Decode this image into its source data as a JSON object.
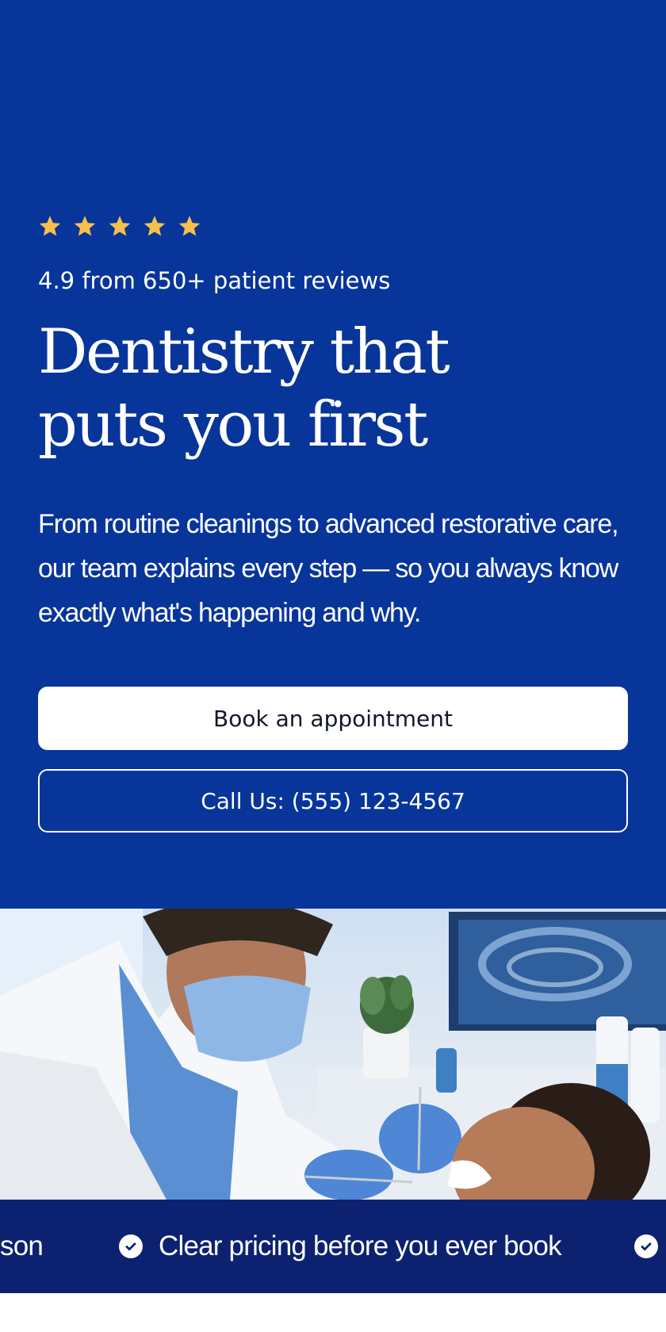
{
  "hero": {
    "rating_text": "4.9 from 650+ patient reviews",
    "star_count": 5,
    "star_color": "#f6c04b",
    "headline_line1": "Dentistry that",
    "headline_line2": "puts you first",
    "subtitle": "From routine cleanings to advanced restorative care, our team explains every step — so you always know exactly what's happening and why.",
    "background_color": "#08359a"
  },
  "buttons": {
    "book_label": "Book an appointment",
    "call_label": "Call Us: (555) 123-4567"
  },
  "ticker": {
    "items": [
      "son",
      "Clear pricing before you ever book"
    ],
    "icon": "check-circle-icon",
    "background_color": "#0c2270"
  },
  "photo": {
    "subject": "dentist-examining-patient-image"
  }
}
